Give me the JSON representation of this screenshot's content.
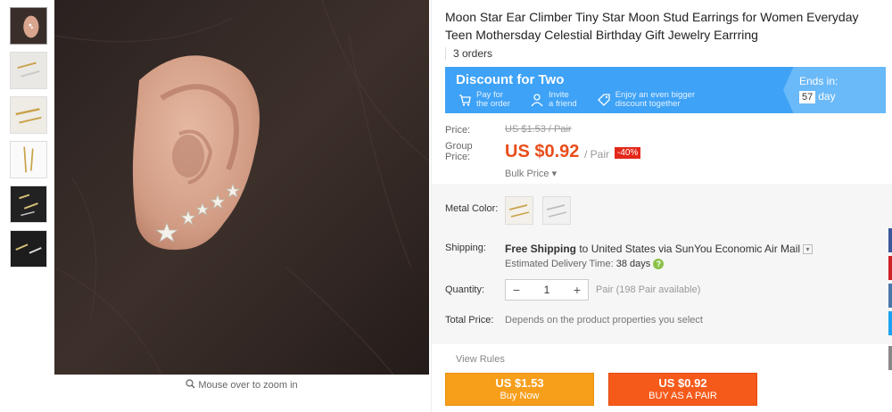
{
  "product": {
    "title": "Moon Star Ear Climber Tiny Star Moon Stud Earrings for Women Everyday Teen Mothersday Celestial Birthday Gift Jewelry Earrring",
    "orders": "3 orders"
  },
  "gallery": {
    "zoom_hint": "Mouse over to zoom in"
  },
  "discount": {
    "title": "Discount for Two",
    "steps": [
      {
        "line1": "Pay for",
        "line2": "the order",
        "icon": "cart-icon"
      },
      {
        "line1": "Invite",
        "line2": "a friend",
        "icon": "person-icon"
      },
      {
        "line1": "Enjoy an even bigger",
        "line2": "discount together",
        "icon": "tag-icon"
      }
    ],
    "ends_label": "Ends in:",
    "ends_days": "57",
    "ends_unit": "day"
  },
  "price": {
    "price_label": "Price:",
    "original": "US $1.53 / Pair",
    "group_label_1": "Group",
    "group_label_2": "Price:",
    "group_price": "US $0.92",
    "unit": "/ Pair",
    "discount_badge": "-40%",
    "bulk": "Bulk Price ▾"
  },
  "attributes": {
    "metal_color_label": "Metal Color:",
    "shipping_label": "Shipping:",
    "shipping_free": "Free Shipping",
    "shipping_rest": " to United States via SunYou Economic Air Mail",
    "delivery_label": "Estimated Delivery Time:",
    "delivery_days": "38 days",
    "quantity_label": "Quantity:",
    "quantity_value": "1",
    "quantity_available": "Pair (198 Pair available)",
    "total_label": "Total Price:",
    "total_text": "Depends on the product properties you select"
  },
  "actions": {
    "view_rules": "View Rules",
    "buy_now_price": "US $1.53",
    "buy_now_label": "Buy Now",
    "buy_pair_price": "US $0.92",
    "buy_pair_label": "BUY AS A PAIR"
  },
  "colors": {
    "accent_orange": "#f79e1b",
    "pair_orange": "#f65a1b",
    "price_red": "#e94e1b",
    "banner_blue": "#3ea2f6",
    "social": [
      "#3b5998",
      "#cc2127",
      "#4a76a8",
      "#1da1f2",
      "#888888"
    ]
  }
}
